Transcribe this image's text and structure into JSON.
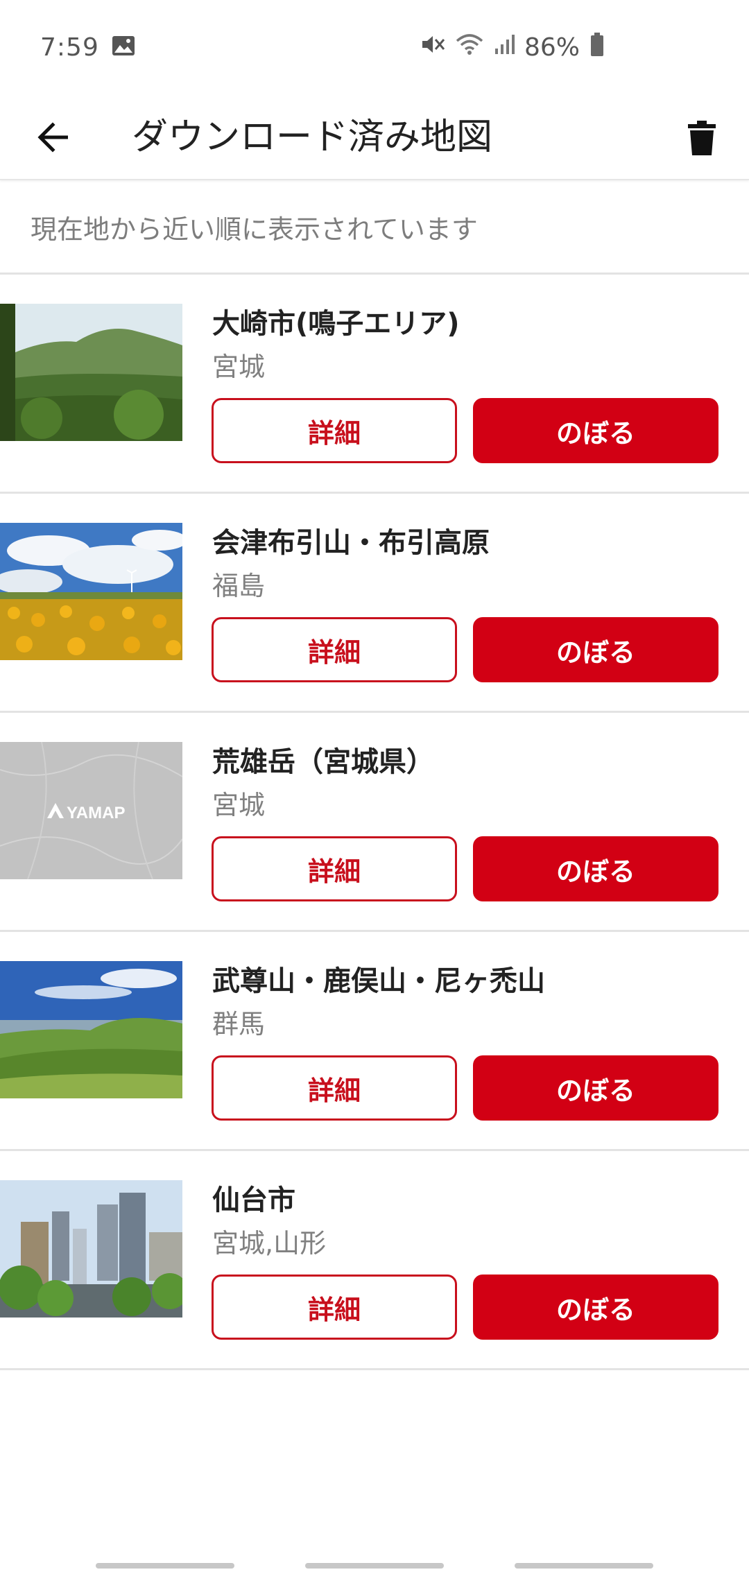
{
  "status_bar": {
    "time": "7:59",
    "battery": "86%",
    "icons": [
      "image-icon",
      "mute-icon",
      "wifi-icon",
      "signal-icon",
      "battery-icon"
    ]
  },
  "app_bar": {
    "title": "ダウンロード済み地図",
    "back_icon": "back-arrow-icon",
    "delete_icon": "trash-icon"
  },
  "notice": "現在地から近い順に表示されています",
  "maps": [
    {
      "name": "大崎市(鳴子エリア)",
      "prefecture": "宮城",
      "detail_label": "詳細",
      "climb_label": "のぼる",
      "thumbnail": "mountain-forest-photo"
    },
    {
      "name": "会津布引山・布引高原",
      "prefecture": "福島",
      "detail_label": "詳細",
      "climb_label": "のぼる",
      "thumbnail": "sunflower-field-photo"
    },
    {
      "name": "荒雄岳（宮城県）",
      "prefecture": "宮城",
      "detail_label": "詳細",
      "climb_label": "のぼる",
      "thumbnail": "yamap-placeholder",
      "thumbnail_text": "YAMAP"
    },
    {
      "name": "武尊山・鹿俣山・尼ヶ禿山",
      "prefecture": "群馬",
      "detail_label": "詳細",
      "climb_label": "のぼる",
      "thumbnail": "green-ridge-photo"
    },
    {
      "name": "仙台市",
      "prefecture": "宮城,山形",
      "detail_label": "詳細",
      "climb_label": "のぼる",
      "thumbnail": "city-skyline-photo"
    }
  ],
  "colors": {
    "accent": "#d20014",
    "divider": "#e3e3e3",
    "secondary_text": "#808080"
  }
}
